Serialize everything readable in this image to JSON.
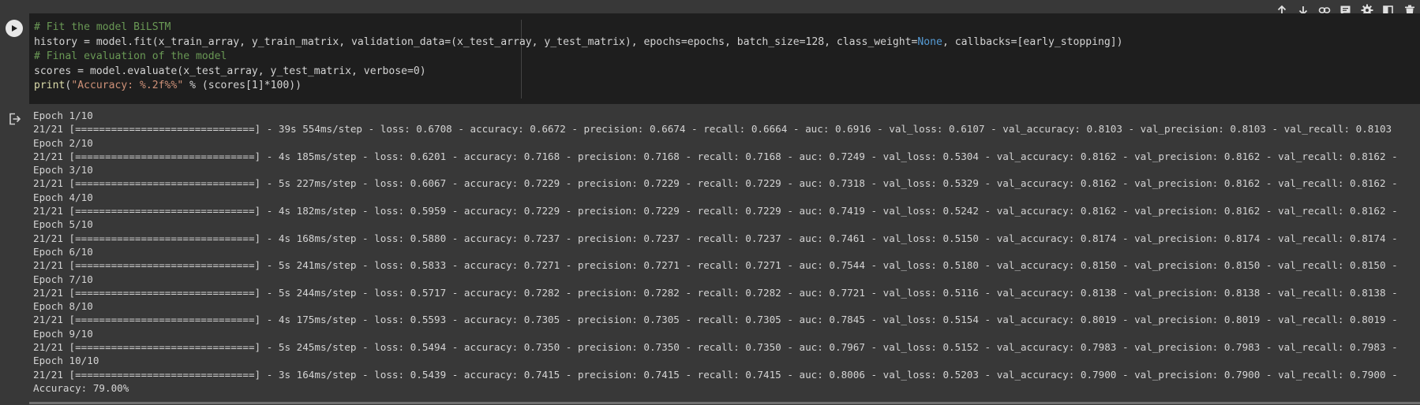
{
  "toolbar": {
    "buttons": [
      {
        "name": "move-cell-up-button",
        "icon": "arrow-up-icon"
      },
      {
        "name": "move-cell-down-button",
        "icon": "arrow-down-icon"
      },
      {
        "name": "copy-link-button",
        "icon": "link-icon"
      },
      {
        "name": "add-comment-button",
        "icon": "comment-icon"
      },
      {
        "name": "cell-settings-button",
        "icon": "gear-icon"
      },
      {
        "name": "mirror-cell-button",
        "icon": "mirror-icon"
      },
      {
        "name": "delete-cell-button",
        "icon": "trash-icon"
      }
    ]
  },
  "code_cell": {
    "lines": [
      [
        {
          "t": "# Fit the model BiLSTM",
          "c": "comment"
        }
      ],
      [
        {
          "t": "history = model.fit(x_train_array, y_train_matrix, validation_data=(x_test_array, y_test_matrix), epochs=epochs, batch_size=128, class_weight=",
          "c": "plain"
        },
        {
          "t": "None",
          "c": "kw"
        },
        {
          "t": ", callbacks=[early_stopping])",
          "c": "plain"
        }
      ],
      [
        {
          "t": "# Final evaluation of the model",
          "c": "comment"
        }
      ],
      [
        {
          "t": "scores = model.evaluate(x_test_array, y_test_matrix, verbose=0)",
          "c": "plain"
        }
      ],
      [
        {
          "t": "print",
          "c": "fn"
        },
        {
          "t": "(",
          "c": "plain"
        },
        {
          "t": "\"Accuracy: %.2f%%\"",
          "c": "string"
        },
        {
          "t": " % (scores[1]*100))",
          "c": "plain"
        }
      ]
    ]
  },
  "output": {
    "lines": [
      "Epoch 1/10",
      "21/21 [==============================] - 39s 554ms/step - loss: 0.6708 - accuracy: 0.6672 - precision: 0.6674 - recall: 0.6664 - auc: 0.6916 - val_loss: 0.6107 - val_accuracy: 0.8103 - val_precision: 0.8103 - val_recall: 0.8103",
      "Epoch 2/10",
      "21/21 [==============================] - 4s 185ms/step - loss: 0.6201 - accuracy: 0.7168 - precision: 0.7168 - recall: 0.7168 - auc: 0.7249 - val_loss: 0.5304 - val_accuracy: 0.8162 - val_precision: 0.8162 - val_recall: 0.8162 -",
      "Epoch 3/10",
      "21/21 [==============================] - 5s 227ms/step - loss: 0.6067 - accuracy: 0.7229 - precision: 0.7229 - recall: 0.7229 - auc: 0.7318 - val_loss: 0.5329 - val_accuracy: 0.8162 - val_precision: 0.8162 - val_recall: 0.8162 -",
      "Epoch 4/10",
      "21/21 [==============================] - 4s 182ms/step - loss: 0.5959 - accuracy: 0.7229 - precision: 0.7229 - recall: 0.7229 - auc: 0.7419 - val_loss: 0.5242 - val_accuracy: 0.8162 - val_precision: 0.8162 - val_recall: 0.8162 -",
      "Epoch 5/10",
      "21/21 [==============================] - 4s 168ms/step - loss: 0.5880 - accuracy: 0.7237 - precision: 0.7237 - recall: 0.7237 - auc: 0.7461 - val_loss: 0.5150 - val_accuracy: 0.8174 - val_precision: 0.8174 - val_recall: 0.8174 -",
      "Epoch 6/10",
      "21/21 [==============================] - 5s 241ms/step - loss: 0.5833 - accuracy: 0.7271 - precision: 0.7271 - recall: 0.7271 - auc: 0.7544 - val_loss: 0.5180 - val_accuracy: 0.8150 - val_precision: 0.8150 - val_recall: 0.8150 -",
      "Epoch 7/10",
      "21/21 [==============================] - 5s 244ms/step - loss: 0.5717 - accuracy: 0.7282 - precision: 0.7282 - recall: 0.7282 - auc: 0.7721 - val_loss: 0.5116 - val_accuracy: 0.8138 - val_precision: 0.8138 - val_recall: 0.8138 -",
      "Epoch 8/10",
      "21/21 [==============================] - 4s 175ms/step - loss: 0.5593 - accuracy: 0.7305 - precision: 0.7305 - recall: 0.7305 - auc: 0.7845 - val_loss: 0.5154 - val_accuracy: 0.8019 - val_precision: 0.8019 - val_recall: 0.8019 -",
      "Epoch 9/10",
      "21/21 [==============================] - 5s 245ms/step - loss: 0.5494 - accuracy: 0.7350 - precision: 0.7350 - recall: 0.7350 - auc: 0.7967 - val_loss: 0.5152 - val_accuracy: 0.7983 - val_precision: 0.7983 - val_recall: 0.7983 -",
      "Epoch 10/10",
      "21/21 [==============================] - 3s 164ms/step - loss: 0.5439 - accuracy: 0.7415 - precision: 0.7415 - recall: 0.7415 - auc: 0.8006 - val_loss: 0.5203 - val_accuracy: 0.7900 - val_precision: 0.7900 - val_recall: 0.7900 -",
      "Accuracy: 79.00%"
    ]
  },
  "colors": {
    "background": "#383838",
    "editor": "#1e1e1e",
    "comment": "#6a9955",
    "string": "#ce9178",
    "keyword": "#569cd6",
    "text": "#d4d4d4"
  }
}
